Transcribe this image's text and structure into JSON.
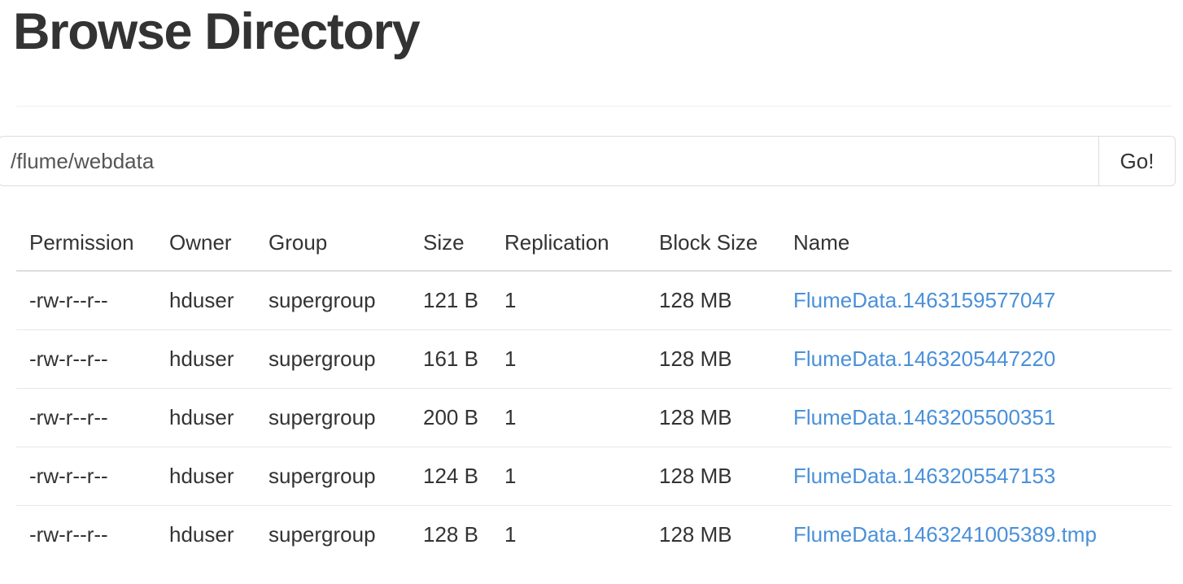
{
  "header": {
    "title": "Browse Directory"
  },
  "path_bar": {
    "value": "/flume/webdata",
    "placeholder": "/",
    "go_label": "Go!"
  },
  "table": {
    "columns": [
      "Permission",
      "Owner",
      "Group",
      "Size",
      "Replication",
      "Block Size",
      "Name"
    ],
    "rows": [
      {
        "permission": "-rw-r--r--",
        "owner": "hduser",
        "group": "supergroup",
        "size": "121 B",
        "replication": "1",
        "block_size": "128 MB",
        "name": "FlumeData.1463159577047"
      },
      {
        "permission": "-rw-r--r--",
        "owner": "hduser",
        "group": "supergroup",
        "size": "161 B",
        "replication": "1",
        "block_size": "128 MB",
        "name": "FlumeData.1463205447220"
      },
      {
        "permission": "-rw-r--r--",
        "owner": "hduser",
        "group": "supergroup",
        "size": "200 B",
        "replication": "1",
        "block_size": "128 MB",
        "name": "FlumeData.1463205500351"
      },
      {
        "permission": "-rw-r--r--",
        "owner": "hduser",
        "group": "supergroup",
        "size": "124 B",
        "replication": "1",
        "block_size": "128 MB",
        "name": "FlumeData.1463205547153"
      },
      {
        "permission": "-rw-r--r--",
        "owner": "hduser",
        "group": "supergroup",
        "size": "128 B",
        "replication": "1",
        "block_size": "128 MB",
        "name": "FlumeData.1463241005389.tmp"
      }
    ]
  },
  "colors": {
    "link": "#4a90d9",
    "text": "#333333",
    "border": "#dddddd",
    "row_border": "#e7e7e7"
  }
}
